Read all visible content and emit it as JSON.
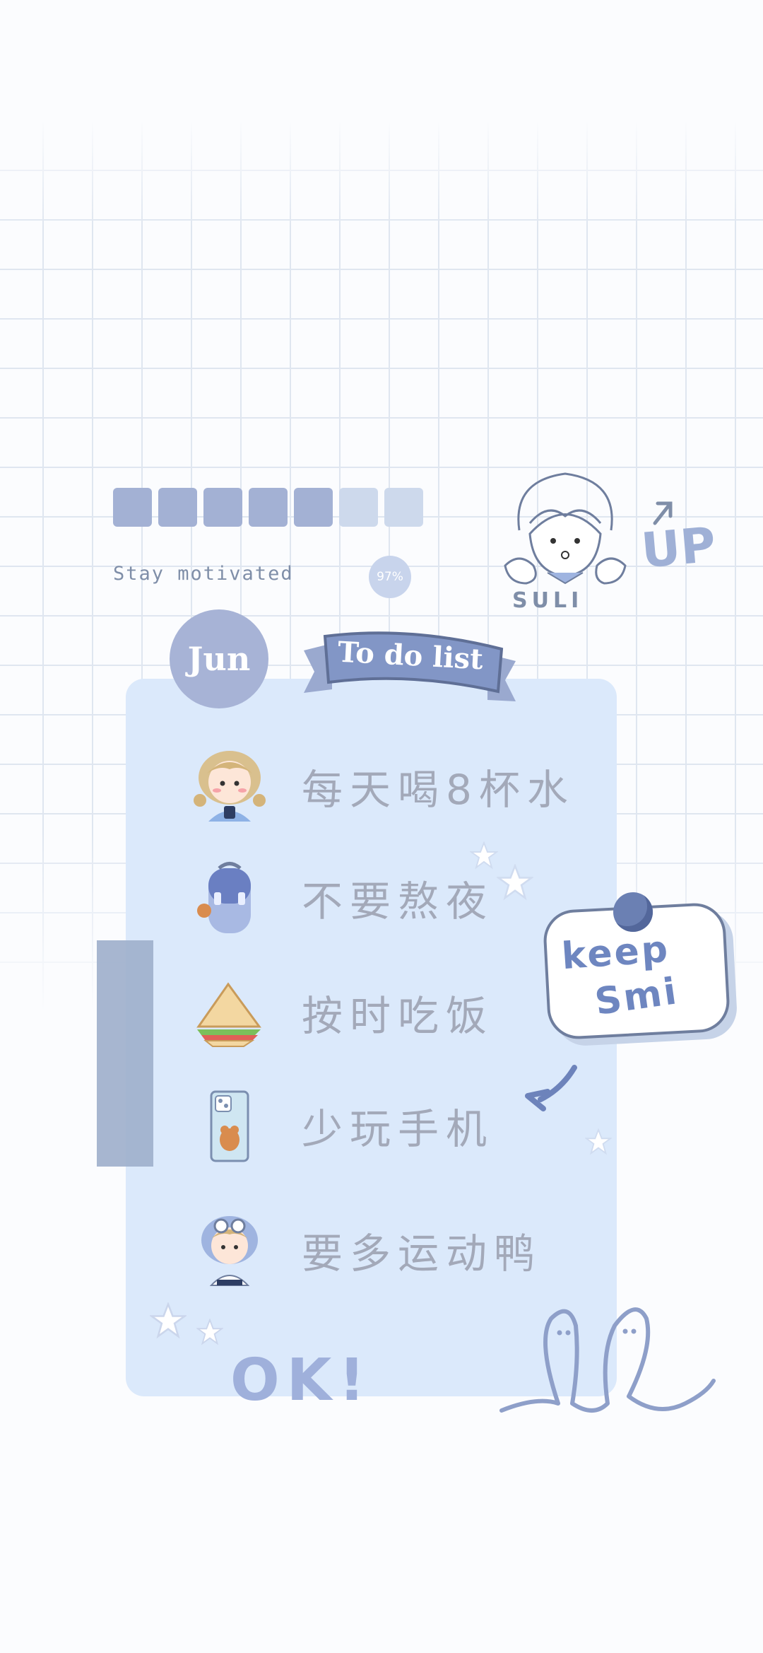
{
  "progress": {
    "filled": 5,
    "total": 7,
    "percent_label": "97%"
  },
  "tagline": "Stay motivated",
  "month": "Jun",
  "banner": "To do list",
  "tasks": [
    {
      "icon": "girl-drinking-icon",
      "text": "每天喝8杯水"
    },
    {
      "icon": "backpack-icon",
      "text": "不要熬夜"
    },
    {
      "icon": "sandwich-icon",
      "text": "按时吃饭"
    },
    {
      "icon": "phone-bear-icon",
      "text": "少玩手机"
    },
    {
      "icon": "girl-goggles-icon",
      "text": "要多运动鸭"
    }
  ],
  "sticker_name": "SULI",
  "up_text": "UP",
  "note": {
    "line1": "keep",
    "line2": "Smi"
  },
  "ok_text": "OK!",
  "colors": {
    "accent": "#a3b1d4",
    "card": "#dbe9fb",
    "text_muted": "#a3a9b9",
    "ink": "#6f7e9e"
  }
}
